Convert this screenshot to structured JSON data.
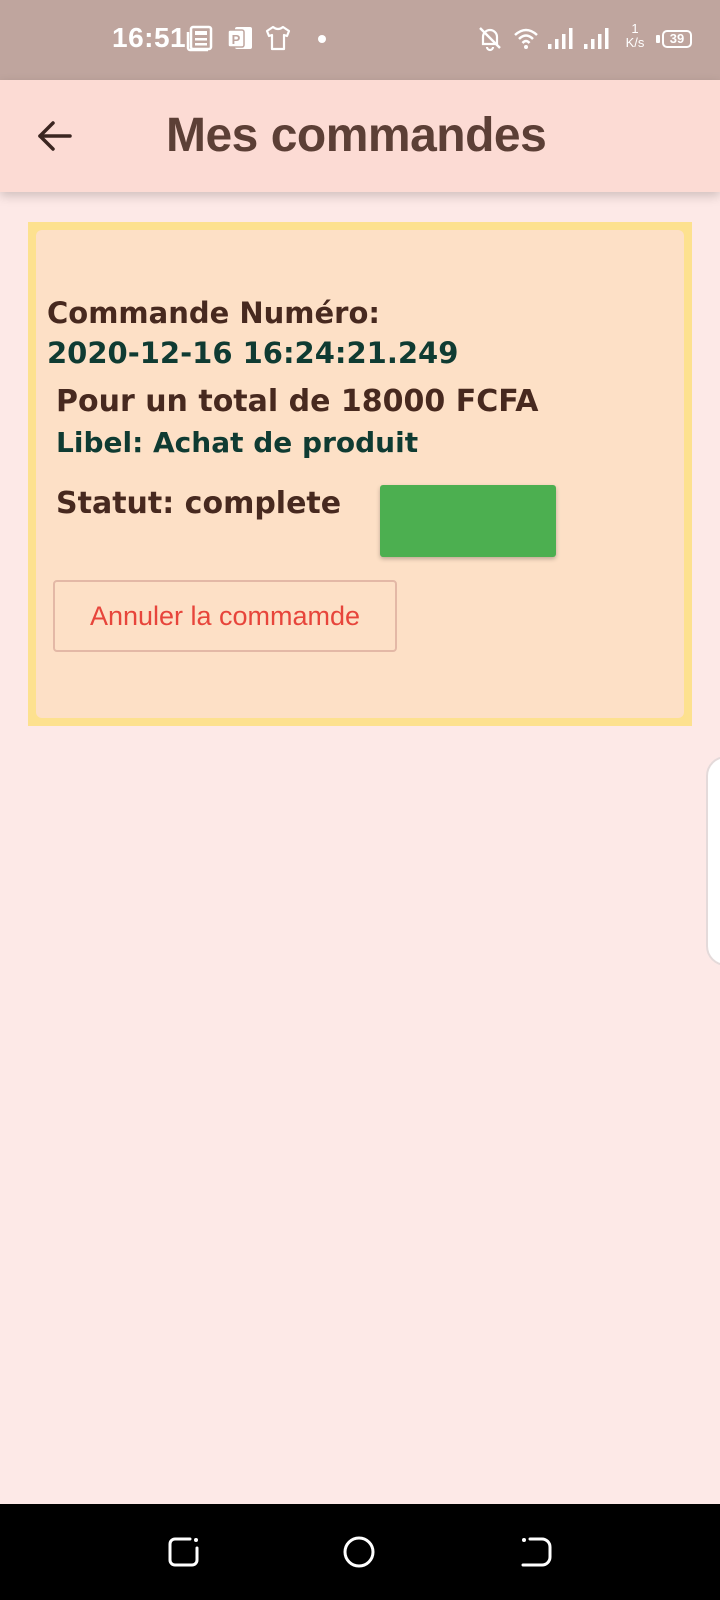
{
  "status_bar": {
    "time": "16:51",
    "net_speed_value": "1",
    "net_speed_unit": "K/s",
    "battery": "39",
    "icons": [
      "news-icon",
      "powerpoint-icon",
      "tshirt-icon",
      "notification-dot",
      "mute-bell-icon",
      "wifi-icon",
      "signal-icon",
      "signal-icon",
      "battery-icon"
    ]
  },
  "app_bar": {
    "back_icon": "arrow-back-icon",
    "title": "Mes commandes"
  },
  "order": {
    "number_label": "Commande Numéro:",
    "number_value": "2020-12-16 16:24:21.249",
    "total": "Pour un total de 18000 FCFA",
    "libel": "Libel: Achat de produit",
    "status": "Statut: complete",
    "status_color": "#4caf50",
    "cancel_label": "Annuler la commamde"
  },
  "nav_bar": {
    "icons": [
      "recent-apps-icon",
      "home-icon",
      "back-icon"
    ]
  },
  "colors": {
    "background": "#fde9e7",
    "app_bar": "#fcdbd4",
    "status_bar": "#bfa59e",
    "card_border": "#fde18f",
    "card_fill": "#fde0c6",
    "title_text": "#5c3f36",
    "dark_text": "#47291f",
    "teal_text": "#0f3b32",
    "cancel_text": "#e7453b"
  }
}
